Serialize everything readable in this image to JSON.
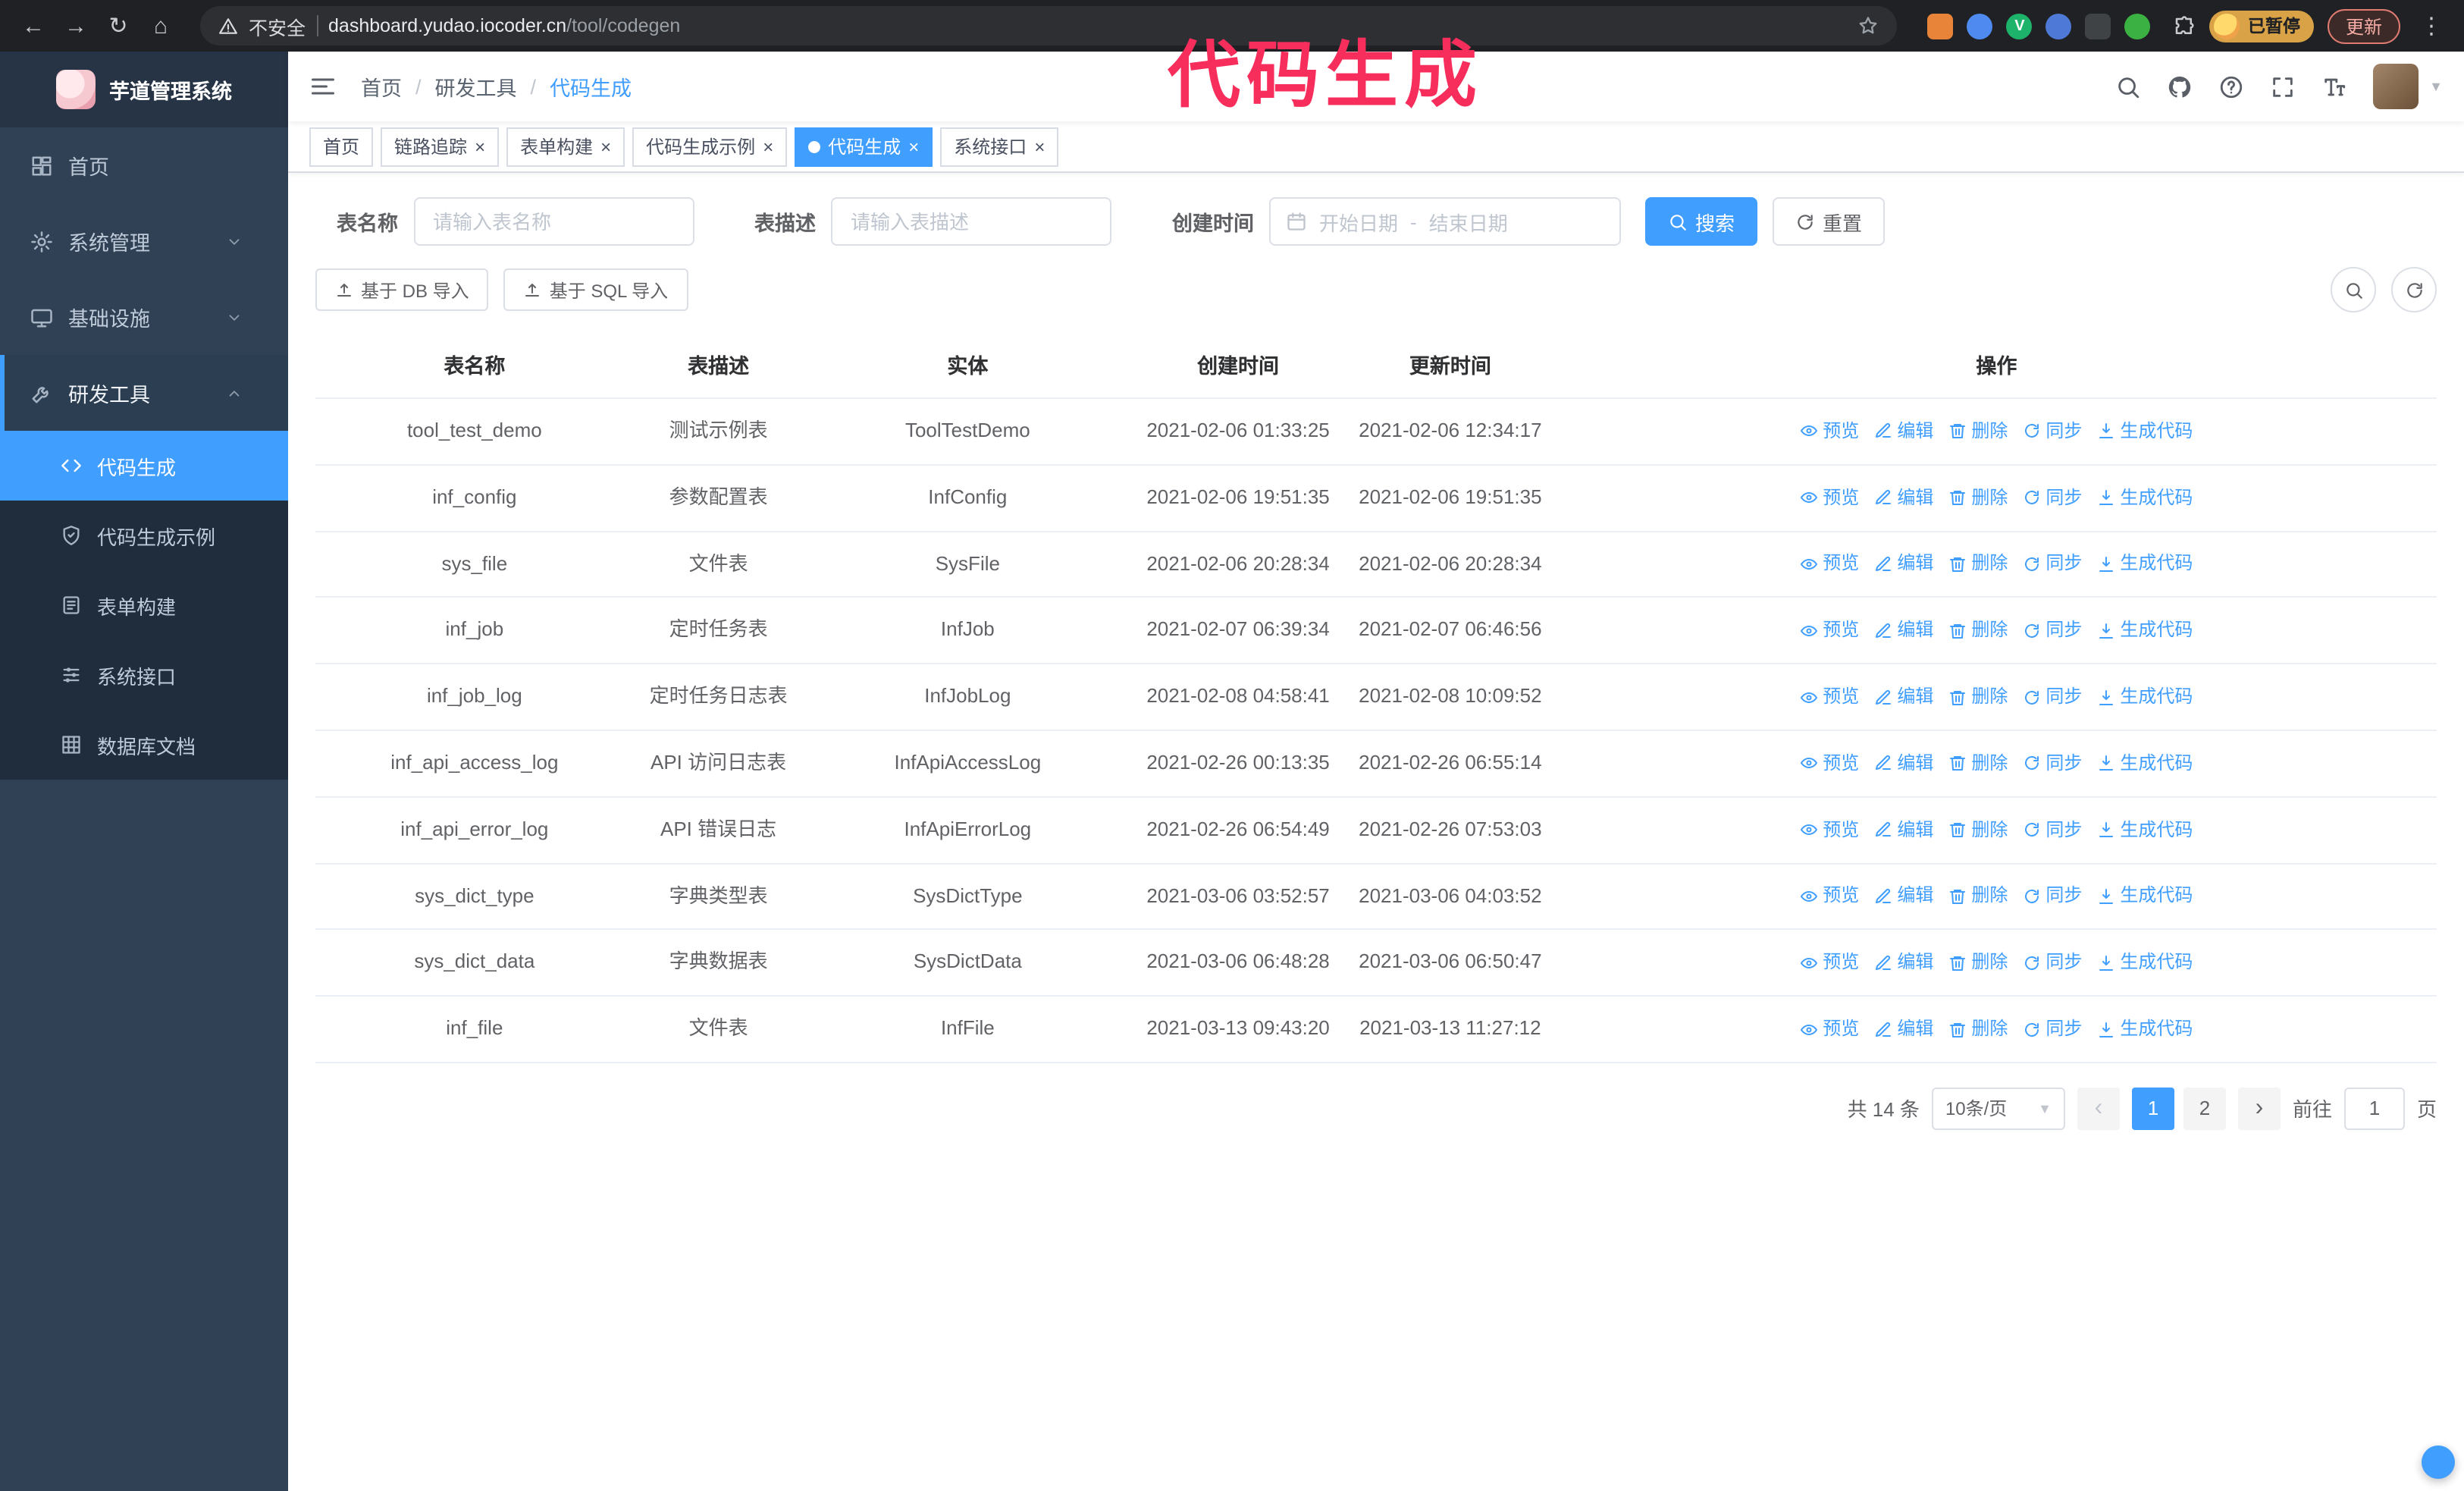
{
  "annotation": {
    "text": "代码生成"
  },
  "browser": {
    "security_warning": "不安全",
    "url_host": "dashboard.yudao.iocoder.cn",
    "url_path": "/tool/codegen",
    "profile_status": "已暂停",
    "update_label": "更新",
    "extensions": [
      {
        "name": "extension-orange-icon",
        "color": "#e8833a",
        "glyph": ""
      },
      {
        "name": "extension-blue-icon",
        "color": "#4e8af0",
        "glyph": ""
      },
      {
        "name": "extension-green-v-icon",
        "color": "#1db36a",
        "glyph": "V"
      },
      {
        "name": "extension-people-icon",
        "color": "#4f79d6",
        "glyph": ""
      },
      {
        "name": "extension-dark-icon",
        "color": "#3f4346",
        "glyph": ""
      },
      {
        "name": "extension-leaf-icon",
        "color": "#3bb143",
        "glyph": ""
      }
    ]
  },
  "app": {
    "title": "芋道管理系统"
  },
  "breadcrumb": [
    "首页",
    "研发工具",
    "代码生成"
  ],
  "sidebar": {
    "items": [
      {
        "key": "home",
        "label": "首页",
        "icon": "home",
        "type": "item",
        "state": "none"
      },
      {
        "key": "system",
        "label": "系统管理",
        "icon": "gear",
        "type": "group",
        "state": "collapsed"
      },
      {
        "key": "infra",
        "label": "基础设施",
        "icon": "monitor",
        "type": "group",
        "state": "collapsed"
      },
      {
        "key": "devtools",
        "label": "研发工具",
        "icon": "tools",
        "type": "group",
        "state": "expanded"
      }
    ],
    "submenu": [
      {
        "key": "codegen",
        "label": "代码生成",
        "icon": "code",
        "active": true
      },
      {
        "key": "codegen-example",
        "label": "代码生成示例",
        "icon": "shield",
        "active": false
      },
      {
        "key": "form-builder",
        "label": "表单构建",
        "icon": "form",
        "active": false
      },
      {
        "key": "api",
        "label": "系统接口",
        "icon": "sliders",
        "active": false
      },
      {
        "key": "db-doc",
        "label": "数据库文档",
        "icon": "dbgrid",
        "active": false
      }
    ]
  },
  "tabs": [
    {
      "key": "home",
      "label": "首页",
      "closable": false,
      "active": false
    },
    {
      "key": "trace",
      "label": "链路追踪",
      "closable": true,
      "active": false
    },
    {
      "key": "form-builder",
      "label": "表单构建",
      "closable": true,
      "active": false
    },
    {
      "key": "codegen-example",
      "label": "代码生成示例",
      "closable": true,
      "active": false
    },
    {
      "key": "codegen",
      "label": "代码生成",
      "closable": true,
      "active": true
    },
    {
      "key": "api",
      "label": "系统接口",
      "closable": true,
      "active": false
    }
  ],
  "filters": {
    "table_name_label": "表名称",
    "table_name_placeholder": "请输入表名称",
    "table_desc_label": "表描述",
    "table_desc_placeholder": "请输入表描述",
    "create_time_label": "创建时间",
    "date_start_placeholder": "开始日期",
    "date_separator": "-",
    "date_end_placeholder": "结束日期",
    "search_label": "搜索",
    "reset_label": "重置"
  },
  "toolbar": {
    "import_db": "基于 DB 导入",
    "import_sql": "基于 SQL 导入"
  },
  "table": {
    "columns": [
      "表名称",
      "表描述",
      "实体",
      "创建时间",
      "更新时间",
      "操作"
    ],
    "row_actions": [
      {
        "key": "preview",
        "label": "预览",
        "icon": "eye"
      },
      {
        "key": "edit",
        "label": "编辑",
        "icon": "edit"
      },
      {
        "key": "delete",
        "label": "删除",
        "icon": "trash"
      },
      {
        "key": "sync",
        "label": "同步",
        "icon": "sync"
      },
      {
        "key": "generate",
        "label": "生成代码",
        "icon": "download"
      }
    ],
    "rows": [
      [
        "tool_test_demo",
        "测试示例表",
        "ToolTestDemo",
        "2021-02-06 01:33:25",
        "2021-02-06 12:34:17"
      ],
      [
        "inf_config",
        "参数配置表",
        "InfConfig",
        "2021-02-06 19:51:35",
        "2021-02-06 19:51:35"
      ],
      [
        "sys_file",
        "文件表",
        "SysFile",
        "2021-02-06 20:28:34",
        "2021-02-06 20:28:34"
      ],
      [
        "inf_job",
        "定时任务表",
        "InfJob",
        "2021-02-07 06:39:34",
        "2021-02-07 06:46:56"
      ],
      [
        "inf_job_log",
        "定时任务日志表",
        "InfJobLog",
        "2021-02-08 04:58:41",
        "2021-02-08 10:09:52"
      ],
      [
        "inf_api_access_log",
        "API 访问日志表",
        "InfApiAccessLog",
        "2021-02-26 00:13:35",
        "2021-02-26 06:55:14"
      ],
      [
        "inf_api_error_log",
        "API 错误日志",
        "InfApiErrorLog",
        "2021-02-26 06:54:49",
        "2021-02-26 07:53:03"
      ],
      [
        "sys_dict_type",
        "字典类型表",
        "SysDictType",
        "2021-03-06 03:52:57",
        "2021-03-06 04:03:52"
      ],
      [
        "sys_dict_data",
        "字典数据表",
        "SysDictData",
        "2021-03-06 06:48:28",
        "2021-03-06 06:50:47"
      ],
      [
        "inf_file",
        "文件表",
        "InfFile",
        "2021-03-13 09:43:20",
        "2021-03-13 11:27:12"
      ]
    ]
  },
  "pagination": {
    "total_label": "共 14 条",
    "page_size_label": "10条/页",
    "pages": [
      {
        "label": "1",
        "active": true
      },
      {
        "label": "2",
        "active": false
      }
    ],
    "goto_label": "前往",
    "goto_value": "1",
    "goto_unit": "页"
  }
}
